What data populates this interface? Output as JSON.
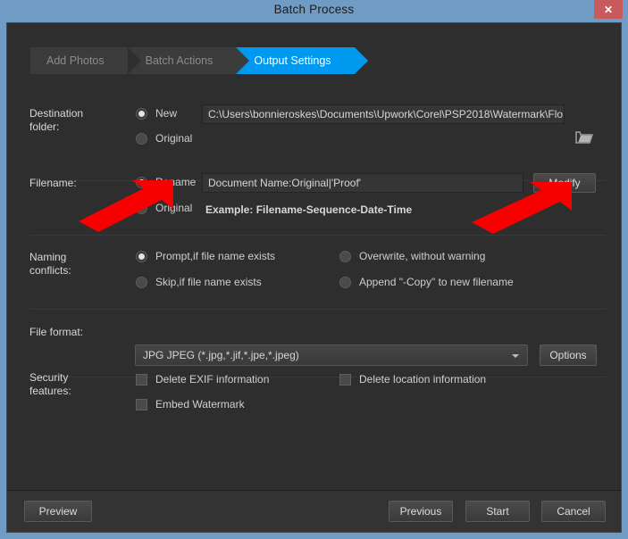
{
  "window": {
    "title": "Batch Process",
    "close_label": "✕"
  },
  "steps": [
    {
      "label": "Add Photos",
      "active": false
    },
    {
      "label": "Batch Actions",
      "active": false
    },
    {
      "label": "Output Settings",
      "active": true
    }
  ],
  "destination": {
    "label_line1": "Destination",
    "label_line2": "folder:",
    "option_new": "New",
    "option_original": "Original",
    "path_value": "C:\\Users\\bonnieroskes\\Documents\\Upwork\\Corel\\PSP2018\\Watermark\\Flo...",
    "browse_icon": "folder-icon"
  },
  "filename": {
    "label": "Filename:",
    "option_rename": "Rename",
    "option_original": "Original",
    "pattern_value": "Document Name:Original|'Proof'",
    "example_text": "Example: Filename-Sequence-Date-Time",
    "modify_button": "Modify"
  },
  "naming_conflicts": {
    "label_line1": "Naming",
    "label_line2": "conflicts:",
    "option_prompt": "Prompt,if file name exists",
    "option_skip": "Skip,if file name exists",
    "option_overwrite": "Overwrite, without warning",
    "option_append": "Append \"-Copy\" to new filename"
  },
  "file_format": {
    "label": "File format:",
    "selected": "JPG JPEG  (*.jpg,*.jif,*.jpe,*.jpeg)",
    "options_button": "Options"
  },
  "security": {
    "label_line1": "Security",
    "label_line2": "features:",
    "delete_exif": "Delete EXIF information",
    "delete_location": "Delete location information",
    "embed_watermark": "Embed Watermark"
  },
  "footer": {
    "preview": "Preview",
    "previous": "Previous",
    "start": "Start",
    "cancel": "Cancel"
  },
  "annotations": {
    "arrow_color": "#f60000",
    "arrow1_target": "rename-radio",
    "arrow2_target": "modify-button"
  },
  "colors": {
    "accent": "#0099f0",
    "titlebar": "#6f9bc4",
    "dialog_bg": "#2e2e2e",
    "close": "#c75b5b"
  }
}
